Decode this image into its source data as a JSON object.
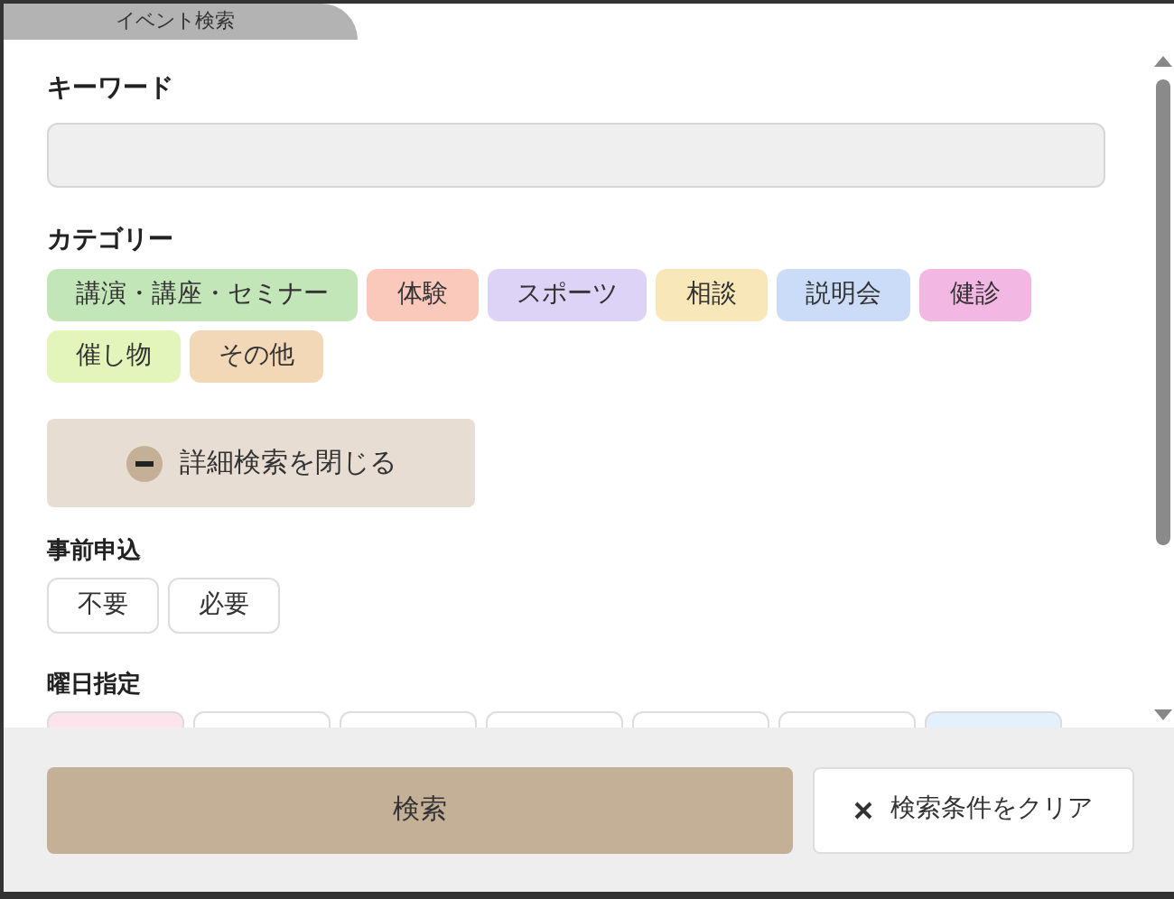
{
  "tab": {
    "label": "イベント検索"
  },
  "keyword": {
    "label": "キーワード"
  },
  "category": {
    "label": "カテゴリー",
    "items": [
      {
        "label": "講演・講座・セミナー",
        "color": "#c3e6b9"
      },
      {
        "label": "体験",
        "color": "#fbc9bb"
      },
      {
        "label": "スポーツ",
        "color": "#dcd3f7"
      },
      {
        "label": "相談",
        "color": "#f8e7b9"
      },
      {
        "label": "説明会",
        "color": "#cadcf8"
      },
      {
        "label": "健診",
        "color": "#f2b7e3"
      },
      {
        "label": "催し物",
        "color": "#e3f5bb"
      },
      {
        "label": "その他",
        "color": "#f3d8b7"
      }
    ]
  },
  "detail_toggle": {
    "label": "詳細検索を閉じる",
    "expanded": true
  },
  "application": {
    "label": "事前申込",
    "options": [
      {
        "label": "不要"
      },
      {
        "label": "必要"
      }
    ]
  },
  "weekday": {
    "label": "曜日指定",
    "items": [
      {
        "color": "#fde3ec"
      },
      {
        "color": "#ffffff"
      },
      {
        "color": "#ffffff"
      },
      {
        "color": "#ffffff"
      },
      {
        "color": "#ffffff"
      },
      {
        "color": "#ffffff"
      },
      {
        "color": "#e3f1fd"
      }
    ]
  },
  "footer": {
    "search": "検索",
    "clear": "検索条件をクリア"
  }
}
